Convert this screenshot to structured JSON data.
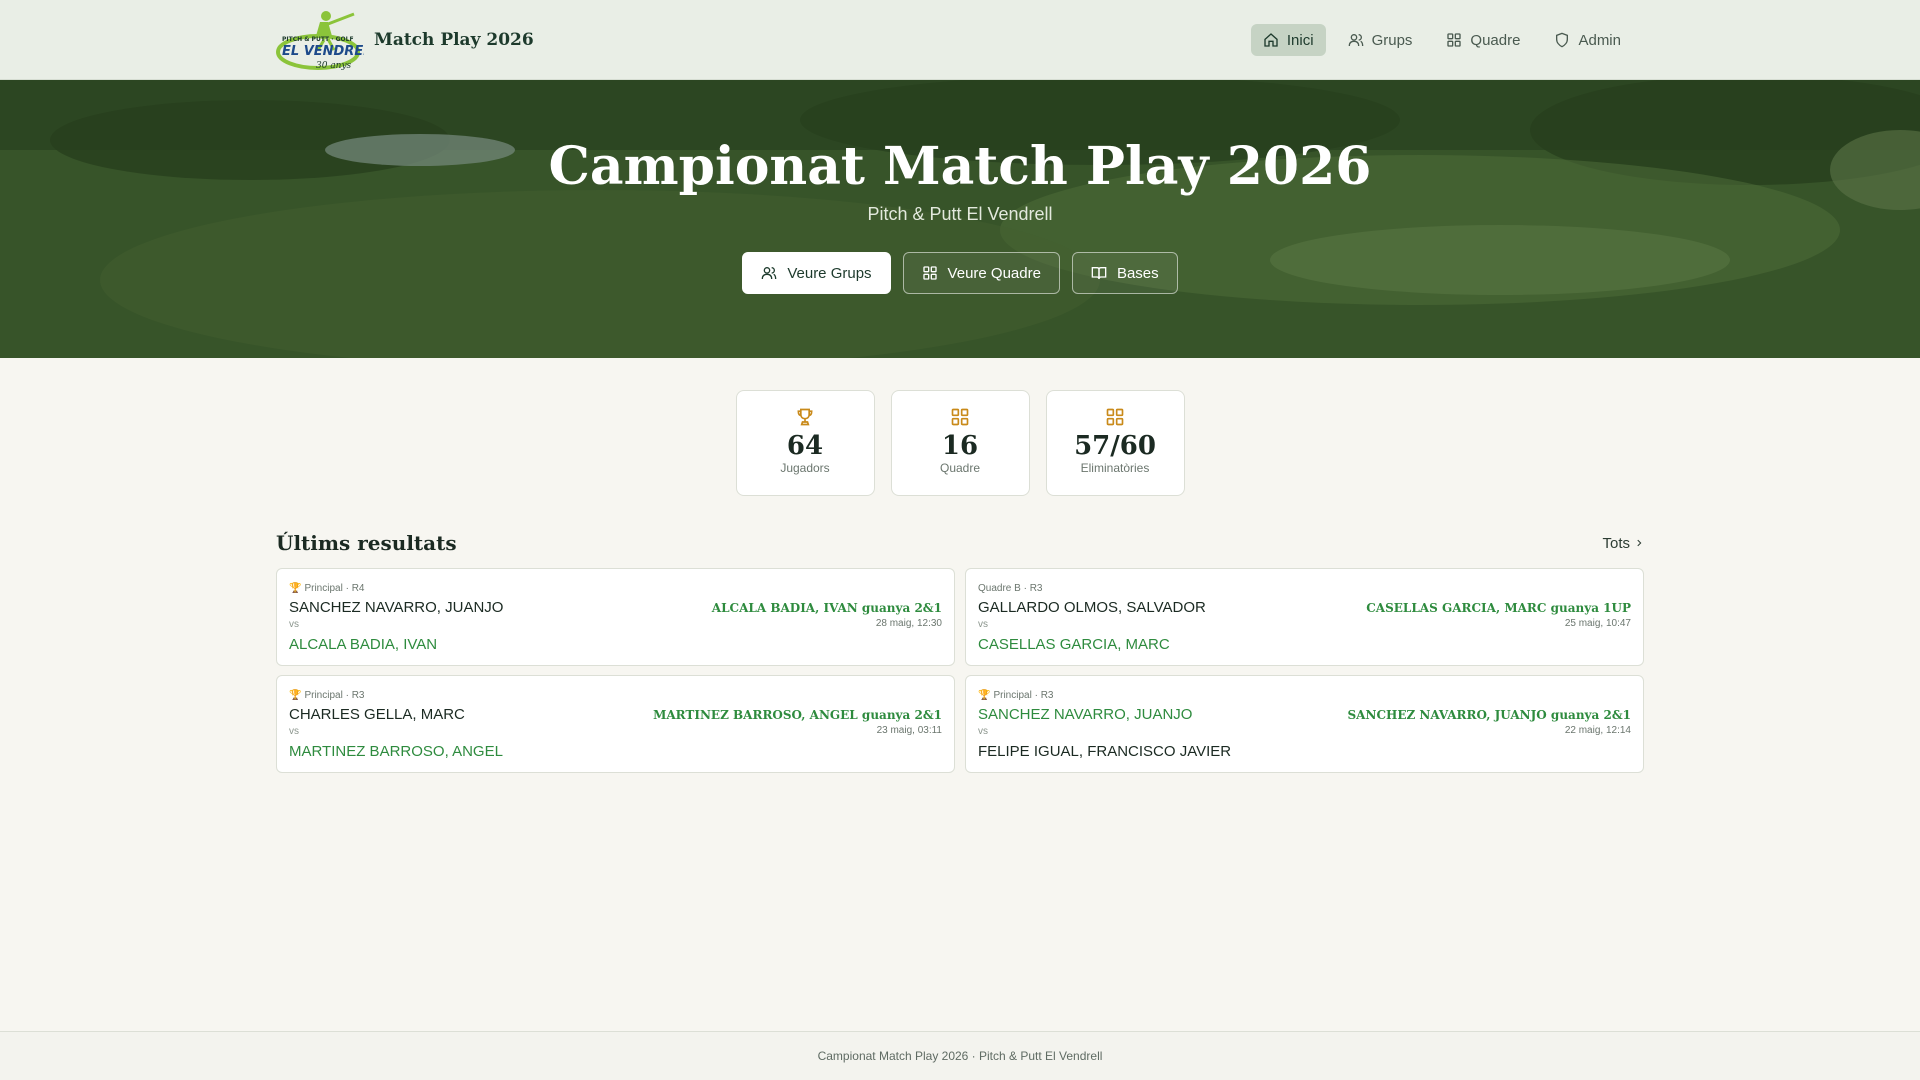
{
  "brand": {
    "logo_text_top": "PITCH & PUTT · GOLF",
    "logo_text_main": "EL VENDRELL",
    "logo_text_sub": "30 anys",
    "title": "Match Play 2026"
  },
  "nav": [
    {
      "label": "Inici",
      "icon": "home-icon",
      "active": true
    },
    {
      "label": "Grups",
      "icon": "users-icon",
      "active": false
    },
    {
      "label": "Quadre",
      "icon": "grid-icon",
      "active": false
    },
    {
      "label": "Admin",
      "icon": "shield-icon",
      "active": false
    }
  ],
  "hero": {
    "title": "Campionat Match Play 2026",
    "subtitle": "Pitch & Putt El Vendrell",
    "buttons": [
      {
        "label": "Veure Grups",
        "icon": "users-icon"
      },
      {
        "label": "Veure Quadre",
        "icon": "grid-icon"
      },
      {
        "label": "Bases",
        "icon": "book-icon"
      }
    ]
  },
  "stats": [
    {
      "value": "64",
      "label": "Jugadors",
      "icon": "trophy-icon"
    },
    {
      "value": "16",
      "label": "Quadre",
      "icon": "grid-icon"
    },
    {
      "value": "57/60",
      "label": "Eliminatòries",
      "icon": "grid-icon"
    }
  ],
  "results": {
    "title": "Últims resultats",
    "see_all": "Tots",
    "matches": [
      {
        "round": "Principal · R4",
        "trophy": true,
        "player1": "SANCHEZ NAVARRO, JUANJO",
        "player2": "ALCALA BADIA, IVAN",
        "winner": 2,
        "vs": "vs",
        "result": "ALCALA BADIA, IVAN guanya 2&1",
        "date": "28 maig, 12:30"
      },
      {
        "round": "Quadre B · R3",
        "trophy": false,
        "player1": "GALLARDO OLMOS, SALVADOR",
        "player2": "CASELLAS GARCIA, MARC",
        "winner": 2,
        "vs": "vs",
        "result": "CASELLAS GARCIA, MARC guanya 1UP",
        "date": "25 maig, 10:47"
      },
      {
        "round": "Principal · R3",
        "trophy": true,
        "player1": "CHARLES GELLA, MARC",
        "player2": "MARTINEZ BARROSO, ANGEL",
        "winner": 2,
        "vs": "vs",
        "result": "MARTINEZ BARROSO, ANGEL guanya 2&1",
        "date": "23 maig, 03:11"
      },
      {
        "round": "Principal · R3",
        "trophy": true,
        "player1": "SANCHEZ NAVARRO, JUANJO",
        "player2": "FELIPE IGUAL, FRANCISCO JAVIER",
        "winner": 1,
        "vs": "vs",
        "result": "SANCHEZ NAVARRO, JUANJO guanya 2&1",
        "date": "22 maig, 12:14"
      }
    ]
  },
  "footer": {
    "text": "Campionat Match Play 2026 · Pitch & Putt El Vendrell"
  },
  "colors": {
    "accent": "#2e8b3e",
    "nav_bg": "#e9eee6",
    "icon_gold": "#c98a1a"
  }
}
